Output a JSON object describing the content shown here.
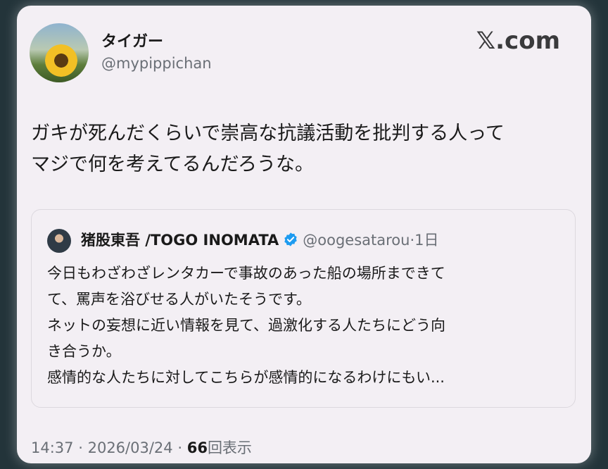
{
  "author": {
    "display_name": "タイガー",
    "handle": "@mypippichan",
    "avatar_icon": "sunflower-avatar"
  },
  "brand": {
    "logo_text": "𝕏.com"
  },
  "tweet": {
    "lines": [
      "ガキが死んだくらいで崇高な抗議活動を批判する人って",
      "マジで何を考えてるんだろうな。"
    ]
  },
  "quoted": {
    "name": "猪股東吾 /TOGO INOMATA",
    "handle": "@oogesatarou",
    "separator": "·",
    "time": "1日",
    "verified_icon": "verified-badge-icon",
    "verified_color": "#1d9bf0",
    "lines": [
      "今日もわざわざレンタカーで事故のあった船の場所まできて、罵声を浴びせる人がいたそうです。",
      "ネットの妄想に近い情報を見て、過激化する人たちにどう向き合うか。",
      "感情的な人たちに対してこちらが感情的になるわけにもい..."
    ],
    "display_lines": [
      "今日もわざわざレンタカーで事故のあった船の場所まできて",
      "て、罵声を浴びせる人がいたそうです。",
      "ネットの妄想に近い情報を見て、過激化する人たちにどう向",
      "き合うか。",
      "感情的な人たちに対してこちらが感情的になるわけにもい..."
    ]
  },
  "footer": {
    "time": "14:37",
    "separator": "·",
    "date": "2026/03/24",
    "views_count": "66",
    "views_label": "回表示"
  }
}
